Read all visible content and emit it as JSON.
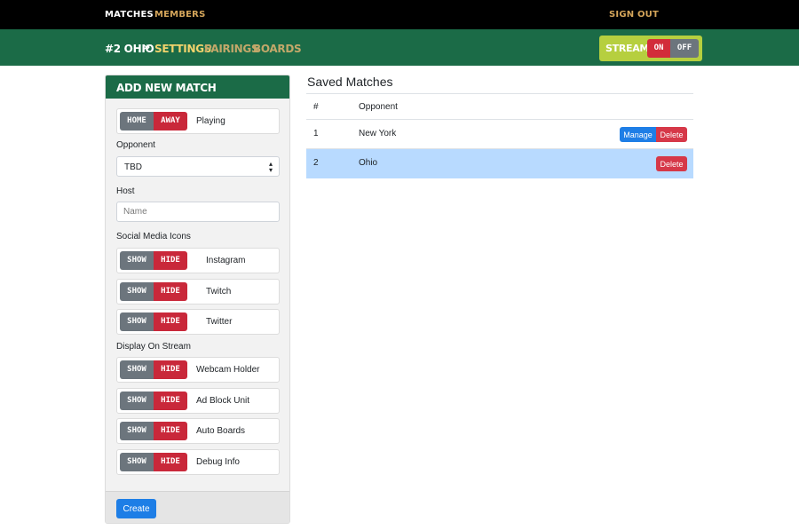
{
  "topnav": {
    "matches": "MATCHES",
    "members": "MEMBERS",
    "sign_out": "SIGN OUT"
  },
  "subnav": {
    "match_name": "#2 OHIO",
    "separator": "»",
    "settings": "SETTINGS",
    "pairings": "PAIRINGS",
    "boards": "BOARDS",
    "stream_label": "STREAM",
    "stream_on": "ON",
    "stream_off": "OFF"
  },
  "form": {
    "title": "ADD NEW MATCH",
    "home_label": "HOME",
    "away_label": "AWAY",
    "playing_label": "Playing",
    "opponent_label": "Opponent",
    "opponent_value": "TBD",
    "host_label": "Host",
    "host_placeholder": "Name",
    "social_label": "Social Media Icons",
    "display_label": "Display On Stream",
    "show_label": "SHOW",
    "hide_label": "HIDE",
    "social_items": [
      "Instagram",
      "Twitch",
      "Twitter"
    ],
    "display_items": [
      "Webcam Holder",
      "Ad Block Unit",
      "Auto Boards",
      "Debug Info"
    ],
    "create_label": "Create"
  },
  "saved": {
    "title": "Saved Matches",
    "col_num": "#",
    "col_opponent": "Opponent",
    "manage_label": "Manage",
    "delete_label": "Delete",
    "rows": [
      {
        "num": "1",
        "opponent": "New York"
      },
      {
        "num": "2",
        "opponent": "Ohio"
      }
    ]
  },
  "colors": {
    "brand_green": "#1b6b47",
    "gold": "#d4a55a",
    "stream_lime": "#b6cf3f",
    "danger": "#d63848",
    "primary": "#1e7ee6",
    "selected_row": "#b8daff"
  }
}
